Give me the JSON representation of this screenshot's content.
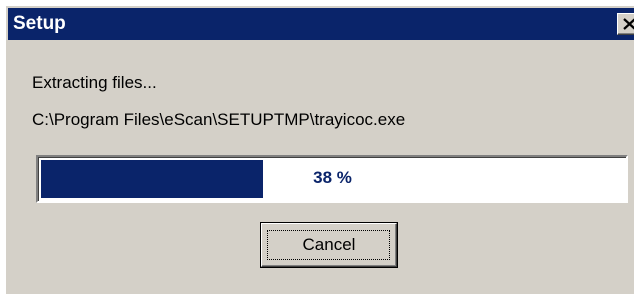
{
  "window": {
    "title": "Setup"
  },
  "status": {
    "action": "Extracting files...",
    "file_path": "C:\\Program Files\\eScan\\SETUPTMP\\trayicoc.exe"
  },
  "progress": {
    "percent": 38,
    "label": "38 %"
  },
  "buttons": {
    "cancel_label": "Cancel"
  },
  "icons": {
    "close": "close-icon"
  },
  "colors": {
    "title_bar": "#0a246a",
    "progress_fill": "#0a246a",
    "window_face": "#d4d0c8"
  }
}
